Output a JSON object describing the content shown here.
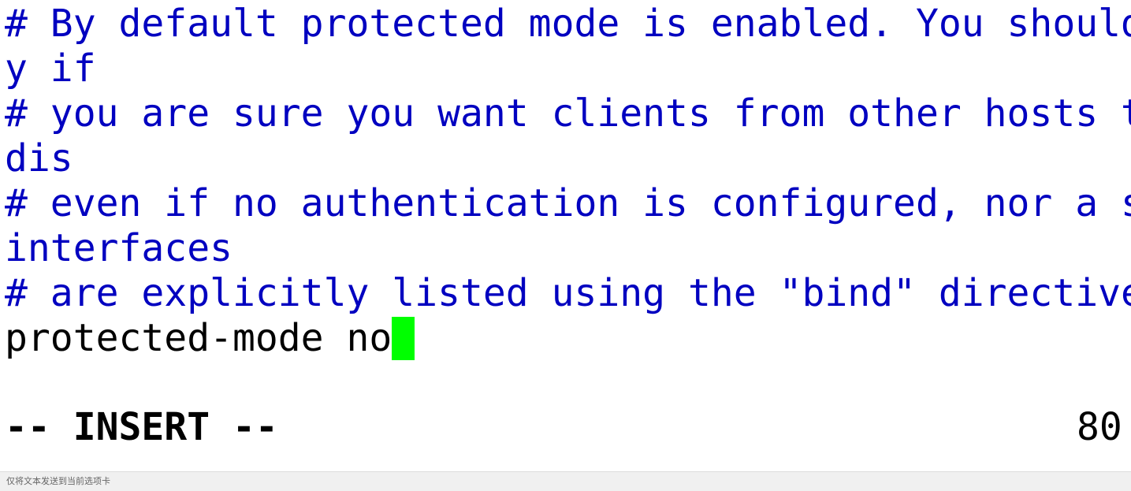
{
  "editor": {
    "lines": [
      "# By default protected mode is enabled. You should disable it onl",
      "y if",
      "# you are sure you want clients from other hosts to connect to Redis",
      "dis",
      "# even if no authentication is configured, nor a specific set of",
      "interfaces",
      "# are explicitly listed using the \"bind\" directive.",
      "protected-mode no"
    ],
    "cursor_color": "#00ff00",
    "comment_color": "#0000c0",
    "text_color": "#000000"
  },
  "status": {
    "mode": "-- INSERT --",
    "position": "80"
  },
  "bottom_bar": {
    "hint": "仅将文本发送到当前选项卡"
  }
}
